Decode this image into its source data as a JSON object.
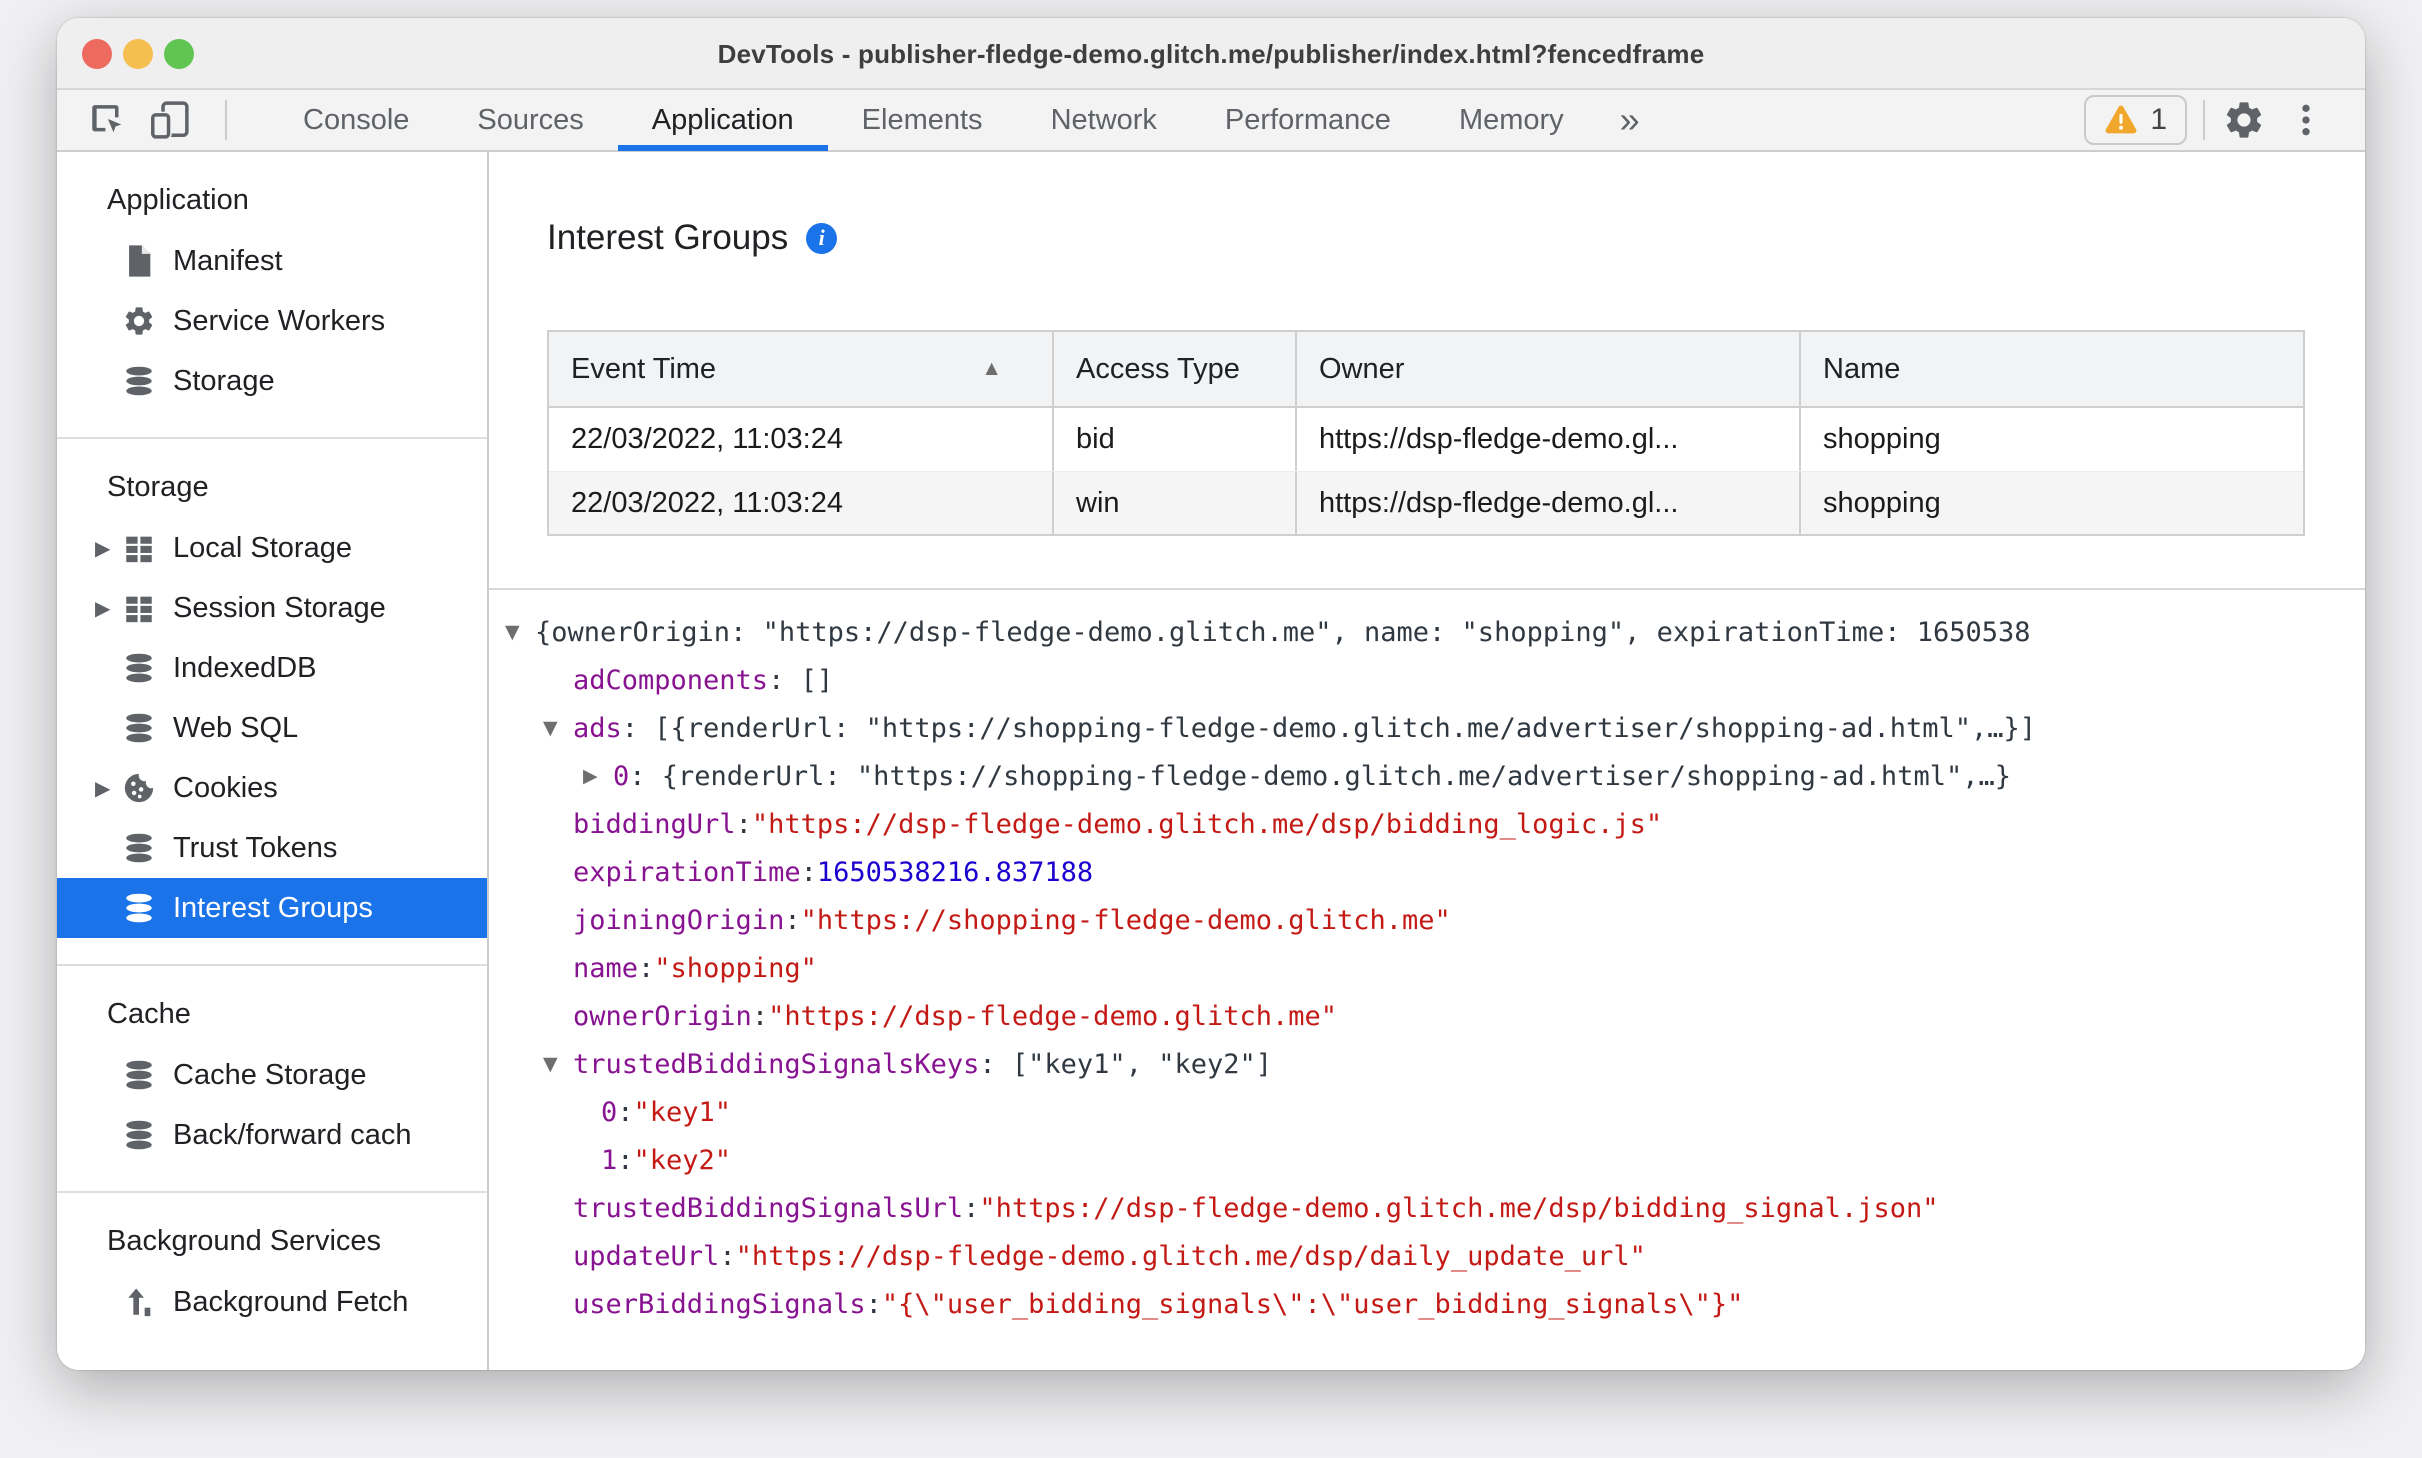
{
  "window_title": "DevTools - publisher-fledge-demo.glitch.me/publisher/index.html?fencedframe",
  "traffic_lights": [
    "close",
    "minimize",
    "zoom"
  ],
  "toolbar": {
    "tabs": [
      {
        "label": "Console",
        "selected": false
      },
      {
        "label": "Sources",
        "selected": false
      },
      {
        "label": "Application",
        "selected": true
      },
      {
        "label": "Elements",
        "selected": false
      },
      {
        "label": "Network",
        "selected": false
      },
      {
        "label": "Performance",
        "selected": false
      },
      {
        "label": "Memory",
        "selected": false
      }
    ],
    "overflow_chevron": "»",
    "warning_badge": "1"
  },
  "sidebar": {
    "sections": [
      {
        "title": "Application",
        "items": [
          {
            "label": "Manifest",
            "icon": "file-icon",
            "expandable": false,
            "selected": false
          },
          {
            "label": "Service Workers",
            "icon": "gear-icon",
            "expandable": false,
            "selected": false
          },
          {
            "label": "Storage",
            "icon": "database-icon",
            "expandable": false,
            "selected": false
          }
        ]
      },
      {
        "title": "Storage",
        "items": [
          {
            "label": "Local Storage",
            "icon": "grid-icon",
            "expandable": true,
            "selected": false
          },
          {
            "label": "Session Storage",
            "icon": "grid-icon",
            "expandable": true,
            "selected": false
          },
          {
            "label": "IndexedDB",
            "icon": "database-icon",
            "expandable": false,
            "selected": false
          },
          {
            "label": "Web SQL",
            "icon": "database-icon",
            "expandable": false,
            "selected": false
          },
          {
            "label": "Cookies",
            "icon": "cookie-icon",
            "expandable": true,
            "selected": false
          },
          {
            "label": "Trust Tokens",
            "icon": "database-icon",
            "expandable": false,
            "selected": false
          },
          {
            "label": "Interest Groups",
            "icon": "database-icon",
            "expandable": false,
            "selected": true
          }
        ]
      },
      {
        "title": "Cache",
        "items": [
          {
            "label": "Cache Storage",
            "icon": "database-icon",
            "expandable": false,
            "selected": false
          },
          {
            "label": "Back/forward cach",
            "icon": "database-icon",
            "expandable": false,
            "selected": false
          }
        ]
      },
      {
        "title": "Background Services",
        "items": [
          {
            "label": "Background Fetch",
            "icon": "fetch-icon",
            "expandable": false,
            "selected": false
          }
        ]
      }
    ]
  },
  "main": {
    "title": "Interest Groups",
    "info_icon": "i",
    "table": {
      "columns": [
        {
          "label": "Event Time",
          "sort": "asc"
        },
        {
          "label": "Access Type",
          "sort": null
        },
        {
          "label": "Owner",
          "sort": null
        },
        {
          "label": "Name",
          "sort": null
        }
      ],
      "rows": [
        [
          "22/03/2022, 11:03:24",
          "bid",
          "https://dsp-fledge-demo.gl...",
          "shopping"
        ],
        [
          "22/03/2022, 11:03:24",
          "win",
          "https://dsp-fledge-demo.gl...",
          "shopping"
        ]
      ]
    },
    "details": {
      "lines": [
        {
          "indent": 0,
          "arrow": "▼",
          "segments": [
            {
              "c": "plain",
              "t": "{ownerOrigin: \"https://dsp-fledge-demo.glitch.me\", name: \"shopping\", expirationTime: 1650538"
            }
          ]
        },
        {
          "indent": 38,
          "arrow": "",
          "segments": [
            {
              "c": "key",
              "t": "adComponents"
            },
            {
              "c": "plain",
              "t": ": []"
            }
          ]
        },
        {
          "indent": 38,
          "arrow": "▼",
          "segments": [
            {
              "c": "key",
              "t": "ads"
            },
            {
              "c": "plain",
              "t": ": [{renderUrl: \"https://shopping-fledge-demo.glitch.me/advertiser/shopping-ad.html\",…}]"
            }
          ]
        },
        {
          "indent": 78,
          "arrow": "▶",
          "segments": [
            {
              "c": "key",
              "t": "0"
            },
            {
              "c": "plain",
              "t": ": {renderUrl: \"https://shopping-fledge-demo.glitch.me/advertiser/shopping-ad.html\",…}"
            }
          ]
        },
        {
          "indent": 38,
          "arrow": "",
          "segments": [
            {
              "c": "key",
              "t": "biddingUrl"
            },
            {
              "c": "plain",
              "t": ": "
            },
            {
              "c": "str",
              "t": "\"https://dsp-fledge-demo.glitch.me/dsp/bidding_logic.js\""
            }
          ]
        },
        {
          "indent": 38,
          "arrow": "",
          "segments": [
            {
              "c": "key",
              "t": "expirationTime"
            },
            {
              "c": "plain",
              "t": ": "
            },
            {
              "c": "num",
              "t": "1650538216.837188"
            }
          ]
        },
        {
          "indent": 38,
          "arrow": "",
          "segments": [
            {
              "c": "key",
              "t": "joiningOrigin"
            },
            {
              "c": "plain",
              "t": ": "
            },
            {
              "c": "str",
              "t": "\"https://shopping-fledge-demo.glitch.me\""
            }
          ]
        },
        {
          "indent": 38,
          "arrow": "",
          "segments": [
            {
              "c": "key",
              "t": "name"
            },
            {
              "c": "plain",
              "t": ": "
            },
            {
              "c": "str",
              "t": "\"shopping\""
            }
          ]
        },
        {
          "indent": 38,
          "arrow": "",
          "segments": [
            {
              "c": "key",
              "t": "ownerOrigin"
            },
            {
              "c": "plain",
              "t": ": "
            },
            {
              "c": "str",
              "t": "\"https://dsp-fledge-demo.glitch.me\""
            }
          ]
        },
        {
          "indent": 38,
          "arrow": "▼",
          "segments": [
            {
              "c": "key",
              "t": "trustedBiddingSignalsKeys"
            },
            {
              "c": "plain",
              "t": ": [\"key1\", \"key2\"]"
            }
          ]
        },
        {
          "indent": 66,
          "arrow": "",
          "segments": [
            {
              "c": "key",
              "t": "0"
            },
            {
              "c": "plain",
              "t": ": "
            },
            {
              "c": "str",
              "t": "\"key1\""
            }
          ]
        },
        {
          "indent": 66,
          "arrow": "",
          "segments": [
            {
              "c": "key",
              "t": "1"
            },
            {
              "c": "plain",
              "t": ": "
            },
            {
              "c": "str",
              "t": "\"key2\""
            }
          ]
        },
        {
          "indent": 38,
          "arrow": "",
          "segments": [
            {
              "c": "key",
              "t": "trustedBiddingSignalsUrl"
            },
            {
              "c": "plain",
              "t": ": "
            },
            {
              "c": "str",
              "t": "\"https://dsp-fledge-demo.glitch.me/dsp/bidding_signal.json\""
            }
          ]
        },
        {
          "indent": 38,
          "arrow": "",
          "segments": [
            {
              "c": "key",
              "t": "updateUrl"
            },
            {
              "c": "plain",
              "t": ": "
            },
            {
              "c": "str",
              "t": "\"https://dsp-fledge-demo.glitch.me/dsp/daily_update_url\""
            }
          ]
        },
        {
          "indent": 38,
          "arrow": "",
          "segments": [
            {
              "c": "key",
              "t": "userBiddingSignals"
            },
            {
              "c": "plain",
              "t": ": "
            },
            {
              "c": "str",
              "t": "\"{\\\"user_bidding_signals\\\":\\\"user_bidding_signals\\\"}\""
            }
          ]
        }
      ]
    }
  },
  "colors": {
    "accent_blue": "#1a73e8",
    "selection_blue": "#1a73e8",
    "key_purple": "#881391",
    "string_red": "#c41a16",
    "number_blue": "#1c00cf",
    "warning_orange": "#f0a72c",
    "traffic_red": "#ec6a5e",
    "traffic_yellow": "#f5bf4f",
    "traffic_green": "#61c554"
  }
}
